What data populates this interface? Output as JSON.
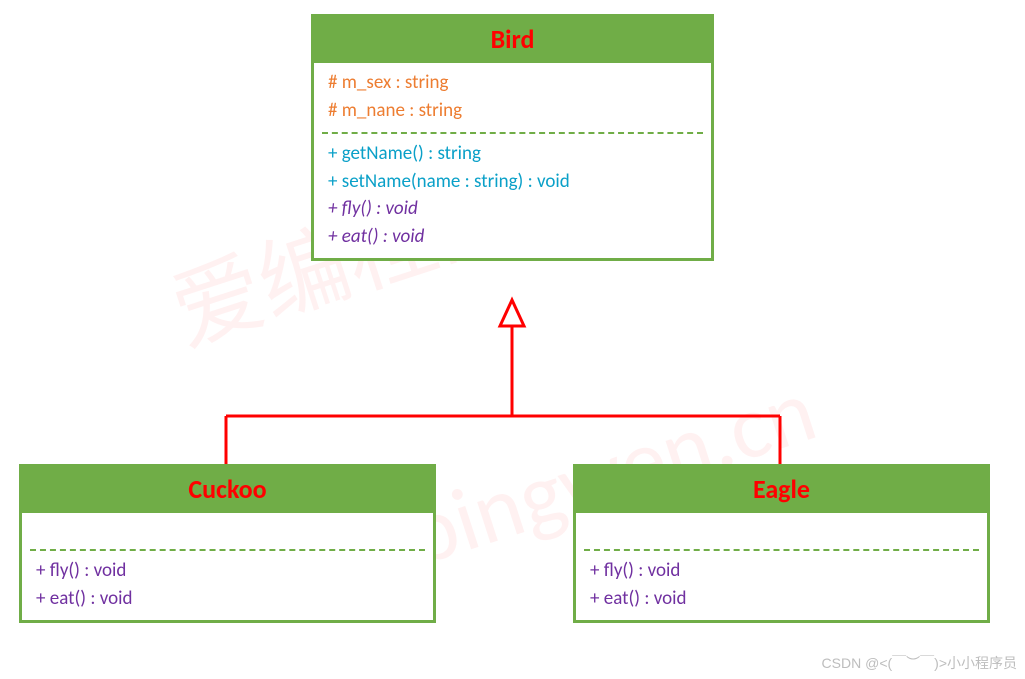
{
  "watermark": {
    "line1": "爱编程的大丙",
    "line2": "subingwen.cn"
  },
  "classes": {
    "bird": {
      "name": "Bird",
      "attributes": [
        "# m_sex : string",
        "# m_nane : string"
      ],
      "methods_concrete": [
        "+ getName() : string",
        "+ setName(name : string) : void"
      ],
      "methods_virtual": [
        "+ fly() : void",
        "+ eat() : void"
      ]
    },
    "cuckoo": {
      "name": "Cuckoo",
      "methods": [
        "+ fly() : void",
        "+ eat() : void"
      ]
    },
    "eagle": {
      "name": "Eagle",
      "methods": [
        "+ fly() : void",
        "+ eat() : void"
      ]
    }
  },
  "relations": [
    {
      "from": "cuckoo",
      "to": "bird",
      "type": "generalization"
    },
    {
      "from": "eagle",
      "to": "bird",
      "type": "generalization"
    }
  ],
  "attribution": "CSDN @<(￣︶￣)>小小程序员",
  "chart_data": {
    "type": "uml-class-diagram",
    "classes": [
      {
        "id": "bird",
        "name": "Bird",
        "attributes": [
          {
            "visibility": "protected",
            "name": "m_sex",
            "type": "string"
          },
          {
            "visibility": "protected",
            "name": "m_nane",
            "type": "string"
          }
        ],
        "operations": [
          {
            "visibility": "public",
            "name": "getName",
            "params": [],
            "return": "string",
            "virtual": false
          },
          {
            "visibility": "public",
            "name": "setName",
            "params": [
              {
                "name": "name",
                "type": "string"
              }
            ],
            "return": "void",
            "virtual": false
          },
          {
            "visibility": "public",
            "name": "fly",
            "params": [],
            "return": "void",
            "virtual": true
          },
          {
            "visibility": "public",
            "name": "eat",
            "params": [],
            "return": "void",
            "virtual": true
          }
        ]
      },
      {
        "id": "cuckoo",
        "name": "Cuckoo",
        "attributes": [],
        "operations": [
          {
            "visibility": "public",
            "name": "fly",
            "params": [],
            "return": "void",
            "virtual": false
          },
          {
            "visibility": "public",
            "name": "eat",
            "params": [],
            "return": "void",
            "virtual": false
          }
        ]
      },
      {
        "id": "eagle",
        "name": "Eagle",
        "attributes": [],
        "operations": [
          {
            "visibility": "public",
            "name": "fly",
            "params": [],
            "return": "void",
            "virtual": false
          },
          {
            "visibility": "public",
            "name": "eat",
            "params": [],
            "return": "void",
            "virtual": false
          }
        ]
      }
    ],
    "relationships": [
      {
        "type": "generalization",
        "child": "cuckoo",
        "parent": "bird"
      },
      {
        "type": "generalization",
        "child": "eagle",
        "parent": "bird"
      }
    ]
  }
}
